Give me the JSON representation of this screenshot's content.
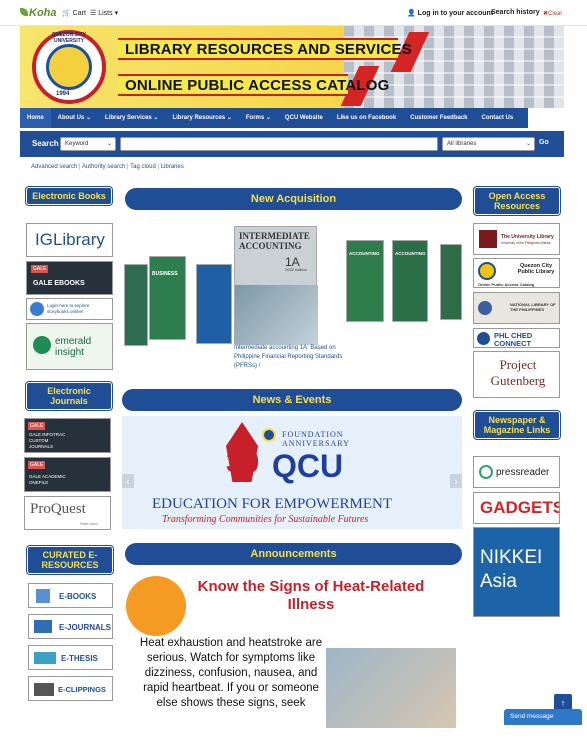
{
  "topbar": {
    "logo": "Koha",
    "cart": "Cart",
    "lists": "Lists",
    "login": "Log in to your account",
    "search_history": "Search history",
    "clear": "Clear"
  },
  "banner": {
    "line1": "LIBRARY RESOURCES AND SERVICES",
    "line2": "ONLINE PUBLIC ACCESS CATALOG",
    "seal_ring": "QUEZON CITY UNIVERSITY",
    "seal_year": "1994"
  },
  "nav": {
    "items": [
      "Home",
      "About Us",
      "Library Services",
      "Library Resources",
      "Forms",
      "QCU Website",
      "Like us on Facebook",
      "Customer Feedback",
      "Contact Us"
    ]
  },
  "search": {
    "label": "Search",
    "type": "Keyword",
    "library": "All libraries",
    "go": "Go"
  },
  "links": [
    "Advanced search",
    "Authority search",
    "Tag cloud",
    "Libraries"
  ],
  "left": {
    "electronic_books": "Electronic Books",
    "eb_tiles": [
      "IGLibrary",
      "GALE EBOOKS",
      "Login here to explore storybooks online!",
      "emerald insight"
    ],
    "electronic_journals": "Electronic Journals",
    "ej_tiles": [
      "GALE INFOTRAC CUSTOM JOURNALS",
      "GALE ACADEMIC ONEFILE",
      "ProQuest"
    ],
    "ej_tile_extra": "Start here.",
    "curated": "CURATED E-RESOURCES",
    "curated_tiles": [
      "E-BOOKS",
      "E-JOURNALS",
      "E-THESIS",
      "E-CLIPPINGS"
    ]
  },
  "center": {
    "new_acq": "New Acquisition",
    "featured_cover_title": "INTERMEDIATE ACCOUNTING",
    "featured_cover_vol": "1A",
    "featured_cover_year": "2022 edition",
    "featured_caption": "Intermediate accounting 1A: Based on Philippine Financial Reporting Standards (PFRSs) /",
    "side_books": [
      "BUSINESS",
      "ACCOUNTING",
      "ACCOUNTING"
    ],
    "news": "News & Events",
    "news_foundation": "FOUNDATION ANNIVERSARY",
    "news_30": "30",
    "news_qcu": "QCU",
    "news_tagline": "EDUCATION FOR EMPOWERMENT",
    "news_sub": "Transforming Communities for Sustainable Futures",
    "announce": "Announcements",
    "announce_title": "Know the Signs of Heat-Related Illness",
    "announce_body": "Heat exhaustion and heatstroke are serious. Watch for symptoms like dizziness, confusion, nausea, and rapid heartbeat. If you or someone else shows these signs, seek"
  },
  "right": {
    "open_access": "Open Access Resources",
    "oa_tiles": [
      "The University Library",
      "Quezon City Public Library",
      "NATIONAL LIBRARY OF THE PHILIPPINES",
      "PHL CHED CONNECT",
      "Project Gutenberg"
    ],
    "oa_extra": [
      "University of the Philippines Manila",
      "Online Public Access Catalog"
    ],
    "newspaper": "Newspaper & Magazine Links",
    "np_tiles": [
      "pressreader",
      "GADGETS",
      "NIKKEI Asia"
    ]
  },
  "widgets": {
    "send_message": "Send message",
    "scroll_top": "↑"
  },
  "colors": {
    "nav_blue": "#1f4e97",
    "heading_yellow": "#f7e046",
    "accent_red": "#c8202a"
  }
}
